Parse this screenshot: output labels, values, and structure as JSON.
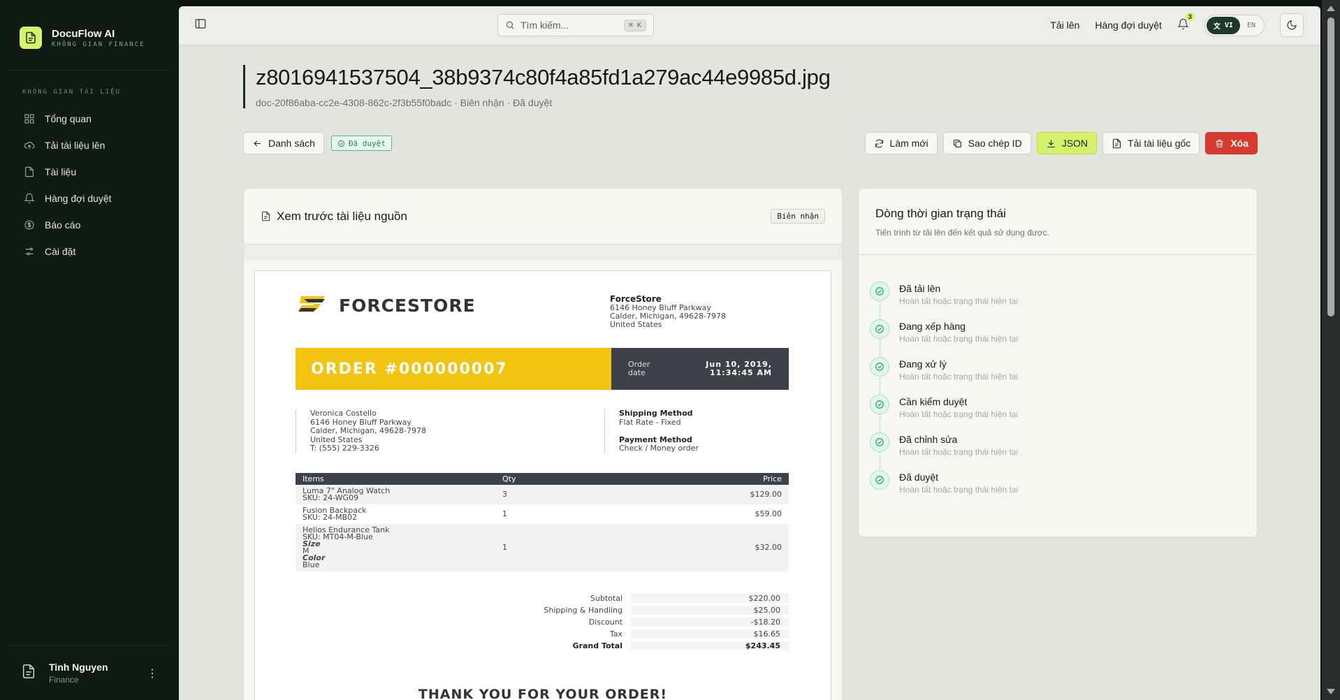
{
  "brand": {
    "name": "DocuFlow AI",
    "subtitle": "KHÔNG GIAN FINANCE"
  },
  "sidebar": {
    "section_label": "KHÔNG GIAN TÀI LIỆU",
    "items": [
      {
        "label": "Tổng quan",
        "icon": "grid-icon"
      },
      {
        "label": "Tải tài liệu lên",
        "icon": "cloud-upload-icon"
      },
      {
        "label": "Tài liệu",
        "icon": "file-icon"
      },
      {
        "label": "Hàng đợi duyệt",
        "icon": "bell-icon"
      },
      {
        "label": "Báo cáo",
        "icon": "dollar-icon"
      },
      {
        "label": "Cài đặt",
        "icon": "sliders-icon"
      }
    ],
    "user": {
      "name": "Tinh Nguyen",
      "role": "Finance"
    }
  },
  "topbar": {
    "search_placeholder": "Tìm kiếm...",
    "search_shortcut": "⌘ K",
    "links": [
      "Tải lên",
      "Hàng đợi duyệt"
    ],
    "notification_count": "3",
    "lang_active": "VI",
    "lang_other": "EN"
  },
  "document": {
    "title": "z8016941537504_38b9374c80f4a85fd1a279ac44e9985d.jpg",
    "meta": "doc-20f86aba-cc2e-4308-862c-2f3b55f0badc · Biên nhận · Đã duyệt",
    "back_label": "Danh sách",
    "status_badge": "Đã duyệt",
    "actions": {
      "refresh": "Làm mới",
      "copy_id": "Sao chép ID",
      "json": "JSON",
      "download": "Tải tài liệu gốc",
      "delete": "Xóa"
    }
  },
  "preview": {
    "title": "Xem trước tài liệu nguồn",
    "type_chip": "Biên nhận",
    "receipt": {
      "logo_text": "FORCESTORE",
      "store_name": "ForceStore",
      "store_address": [
        "6146 Honey Bluff Parkway",
        "Calder, Michigan, 49628-7978",
        "United States"
      ],
      "order_title": "ORDER #000000007",
      "order_date_label": [
        "Order",
        "date"
      ],
      "order_date_value": [
        "Jun 10, 2019,",
        "11:34:45 AM"
      ],
      "customer": [
        "Veronica Costello",
        "6146 Honey Bluff Parkway",
        "Calder, Michigan, 49628-7978",
        "United States",
        "T: (555) 229-3326"
      ],
      "shipping_method_label": "Shipping Method",
      "shipping_method": "Flat Rate - Fixed",
      "payment_method_label": "Payment Method",
      "payment_method": "Check / Money order",
      "columns": [
        "Items",
        "Qty",
        "Price"
      ],
      "items": [
        {
          "name": "Luma 7\" Analog Watch",
          "sku": "SKU: 24-WG09",
          "qty": "3",
          "price": "$129.00"
        },
        {
          "name": "Fusion Backpack",
          "sku": "SKU: 24-MB02",
          "qty": "1",
          "price": "$59.00"
        },
        {
          "name": "Helios Endurance Tank",
          "sku": "SKU: MT04-M-Blue",
          "size_label": "Size",
          "size": "M",
          "color_label": "Color",
          "color": "Blue",
          "qty": "1",
          "price": "$32.00"
        }
      ],
      "totals": [
        {
          "label": "Subtotal",
          "value": "$220.00"
        },
        {
          "label": "Shipping & Handling",
          "value": "$25.00"
        },
        {
          "label": "Discount",
          "value": "-$18.20"
        },
        {
          "label": "Tax",
          "value": "$16.65"
        },
        {
          "label": "Grand Total",
          "value": "$243.45"
        }
      ],
      "thanks": "THANK YOU FOR YOUR ORDER!"
    }
  },
  "timeline": {
    "title": "Dòng thời gian trạng thái",
    "subtitle": "Tiến trình từ tải lên đến kết quả sử dụng được.",
    "steps": [
      {
        "name": "Đã tải lên",
        "desc": "Hoàn tất hoặc trạng thái hiện tại"
      },
      {
        "name": "Đang xếp hàng",
        "desc": "Hoàn tất hoặc trạng thái hiện tại"
      },
      {
        "name": "Đang xử lý",
        "desc": "Hoàn tất hoặc trạng thái hiện tại"
      },
      {
        "name": "Cần kiểm duyệt",
        "desc": "Hoàn tất hoặc trạng thái hiện tại"
      },
      {
        "name": "Đã chỉnh sửa",
        "desc": "Hoàn tất hoặc trạng thái hiện tại"
      },
      {
        "name": "Đã duyệt",
        "desc": "Hoàn tất hoặc trạng thái hiện tại"
      }
    ]
  },
  "colors": {
    "accent": "#d4f26a",
    "sidebar_bg": "#0f1a14",
    "success": "#19a06d",
    "danger": "#d93a2f",
    "receipt_yellow": "#f2c40f"
  }
}
